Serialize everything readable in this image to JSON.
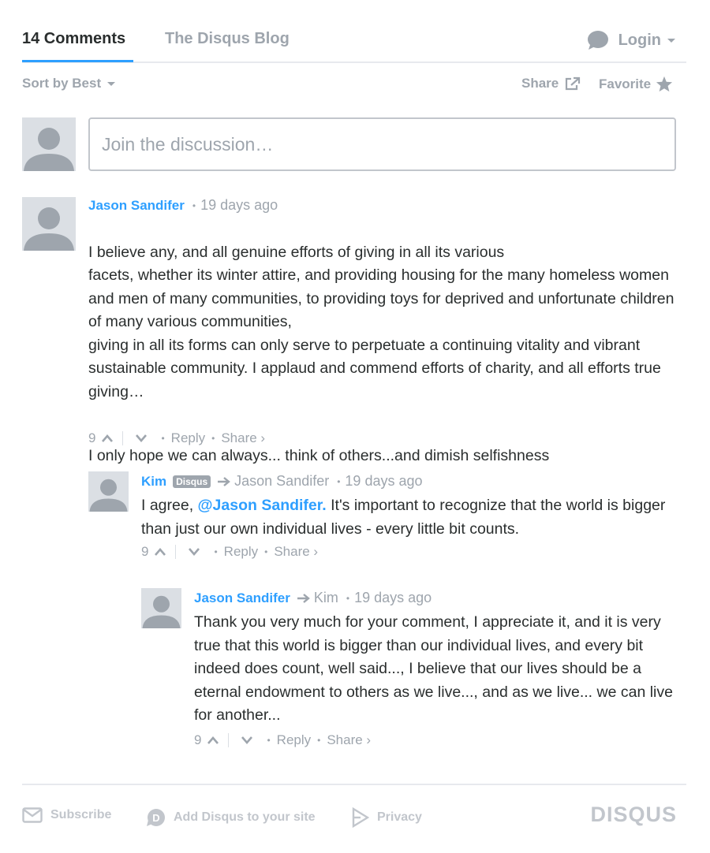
{
  "nav": {
    "comments_tab": "14 Comments",
    "blog_tab": "The Disqus Blog",
    "login_label": "Login"
  },
  "toolbar": {
    "sort_label": "Sort by Best",
    "share_label": "Share",
    "favorite_label": "Favorite"
  },
  "composer": {
    "placeholder": "Join the discussion…"
  },
  "comments": [
    {
      "author": "Jason Sandifer",
      "time": "19 days ago",
      "paragraphs": [
        "I believe any, and all genuine efforts of giving in all its various\nfacets, whether its winter attire, and providing housing for the many homeless women and men of many communities, to providing toys for deprived and unfortunate children of many various communities,\ngiving in all its forms can only serve to perpetuate a continuing vitality and vibrant sustainable community. I applaud and commend efforts of charity, and all efforts true giving…",
        "I only hope we can always... think of others...and dimish selfishness"
      ],
      "votes": "9",
      "reply_label": "Reply",
      "share_label": "Share ›"
    },
    {
      "author": "Kim",
      "badge": "Disqus",
      "reply_to": "Jason Sandifer",
      "time": "19 days ago",
      "text_before": "I agree, ",
      "mention": "@Jason Sandifer.",
      "text_after": " It's important to recognize that the world is bigger than just our own individual lives - every little bit counts.",
      "votes": "9",
      "reply_label": "Reply",
      "share_label": "Share ›"
    },
    {
      "author": "Jason Sandifer",
      "reply_to": "Kim",
      "time": "19 days ago",
      "text": "Thank you very much for your comment, I appreciate it, and it is very true that this world is bigger than our individual lives, and every bit indeed does count, well said..., I believe that our lives should be a eternal endowment to others as we live..., and as we live... we can live for another...",
      "votes": "9",
      "reply_label": "Reply",
      "share_label": "Share ›"
    }
  ],
  "footer": {
    "subscribe": "Subscribe",
    "add_disqus": "Add Disqus to your site",
    "privacy": "Privacy",
    "logo": "DISQUS"
  },
  "colors": {
    "accent": "#2e9fff",
    "muted": "#9ea5ad",
    "text": "#2a2e2e"
  }
}
